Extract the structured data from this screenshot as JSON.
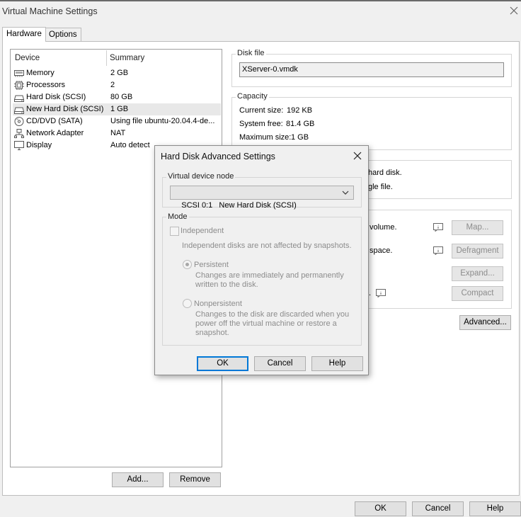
{
  "window": {
    "title": "Virtual Machine Settings"
  },
  "tabs": [
    {
      "label": "Hardware"
    },
    {
      "label": "Options"
    }
  ],
  "device_list": {
    "columns": {
      "device": "Device",
      "summary": "Summary"
    },
    "rows": [
      {
        "device": "Memory",
        "summary": "2 GB",
        "icon": "memory-icon"
      },
      {
        "device": "Processors",
        "summary": "2",
        "icon": "processor-icon"
      },
      {
        "device": "Hard Disk (SCSI)",
        "summary": "80 GB",
        "icon": "hard-disk-icon"
      },
      {
        "device": "New Hard Disk (SCSI)",
        "summary": "1 GB",
        "icon": "hard-disk-icon"
      },
      {
        "device": "CD/DVD (SATA)",
        "summary": "Using file ubuntu-20.04.4-de...",
        "icon": "cd-dvd-icon"
      },
      {
        "device": "Network Adapter",
        "summary": "NAT",
        "icon": "network-adapter-icon"
      },
      {
        "device": "Display",
        "summary": "Auto detect",
        "icon": "display-icon"
      }
    ]
  },
  "list_buttons": {
    "add": "Add...",
    "remove": "Remove"
  },
  "disk_file": {
    "label": "Disk file",
    "value": "XServer-0.vmdk"
  },
  "capacity": {
    "label": "Capacity",
    "current_label": "Current size:",
    "current_value": "192 KB",
    "free_label": "System free:",
    "free_value": "81.4 GB",
    "max_label": "Maximum size:",
    "max_value": "1 GB"
  },
  "partial_text": {
    "disk_info_1": "hard disk.",
    "disk_info_2": "gle file.",
    "util_1": "volume.",
    "util_2": "space.",
    "util_3": "."
  },
  "utility_buttons": {
    "map": "Map...",
    "defragment": "Defragment",
    "expand": "Expand...",
    "compact": "Compact"
  },
  "advanced_button": "Advanced...",
  "footer": {
    "ok": "OK",
    "cancel": "Cancel",
    "help": "Help"
  },
  "dialog": {
    "title": "Hard Disk Advanced Settings",
    "vdn_label": "Virtual device node",
    "vdn_value": "SCSI 0:1   New Hard Disk (SCSI)",
    "mode_label": "Mode",
    "independent_label": "Independent",
    "independent_desc": "Independent disks are not affected by snapshots.",
    "persistent_label": "Persistent",
    "persistent_desc": "Changes are immediately and permanently written to the disk.",
    "nonpersistent_label": "Nonpersistent",
    "nonpersistent_desc": "Changes to the disk are discarded when you power off the virtual machine or restore a snapshot.",
    "ok": "OK",
    "cancel": "Cancel",
    "help": "Help"
  }
}
